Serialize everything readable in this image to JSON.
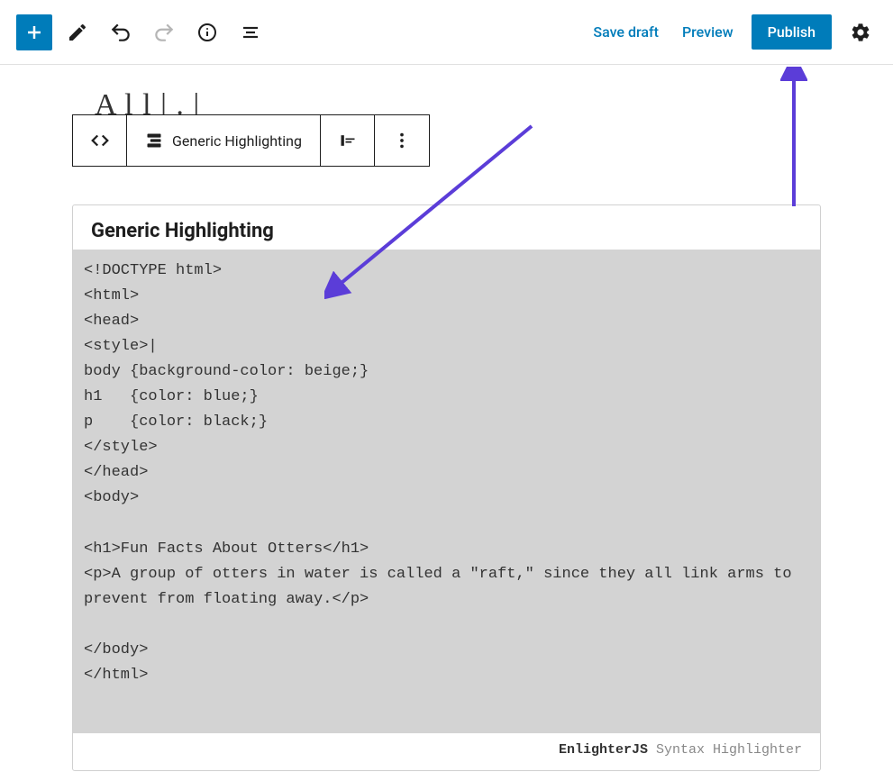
{
  "toolbar": {
    "save_draft_label": "Save draft",
    "preview_label": "Preview",
    "publish_label": "Publish"
  },
  "block_toolbar": {
    "language_label": "Generic Highlighting"
  },
  "faint_title_text": "A  l  l     |     .  |",
  "code_block": {
    "title": "Generic Highlighting",
    "content": "<!DOCTYPE html>\n<html>\n<head>\n<style>|\nbody {background-color: beige;}\nh1   {color: blue;}\np    {color: black;}\n</style>\n</head>\n<body>\n\n<h1>Fun Facts About Otters</h1>\n<p>A group of otters in water is called a \"raft,\" since they all link arms to prevent from floating away.</p>\n\n</body>\n</html>",
    "footer_brand": "EnlighterJS",
    "footer_rest": " Syntax Highlighter"
  },
  "annotations": {
    "arrow_color": "#5b3dd8"
  }
}
